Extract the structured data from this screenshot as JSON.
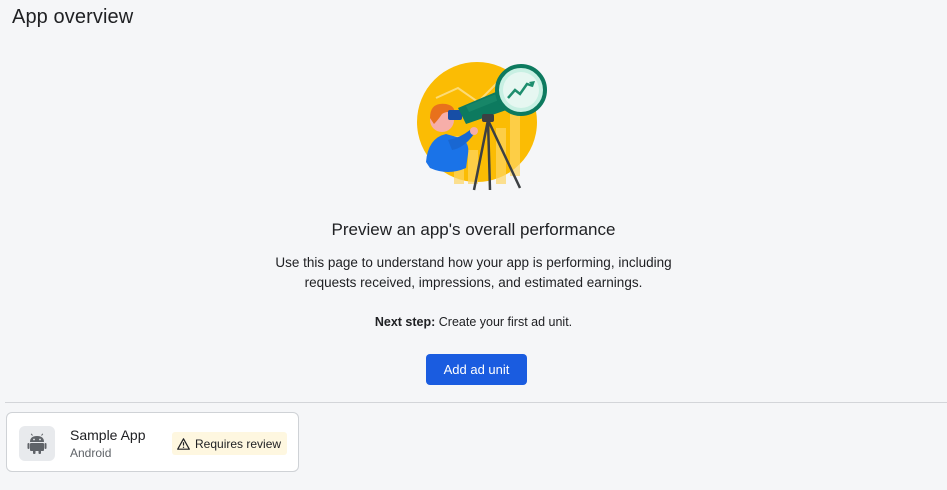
{
  "header": {
    "title": "App overview"
  },
  "empty_state": {
    "illustration": "person-with-telescope-illustration",
    "heading": "Preview an app's overall performance",
    "body_line1": "Use this page to understand how your app is performing, including",
    "body_line2": "requests received, impressions, and estimated earnings.",
    "next_step_label": "Next step:",
    "next_step_text": " Create your first ad unit.",
    "primary_button_label": "Add ad unit"
  },
  "app_card": {
    "icon": "android-icon",
    "name": "Sample App",
    "platform": "Android",
    "status_icon": "warning-icon",
    "status_label": "Requires review"
  },
  "colors": {
    "background": "#f5f6f8",
    "primary": "#1a5ce0",
    "warning_badge_bg": "#fef7e0",
    "illustration_yellow": "#fbbc04",
    "illustration_teal": "#0d7a5f"
  }
}
